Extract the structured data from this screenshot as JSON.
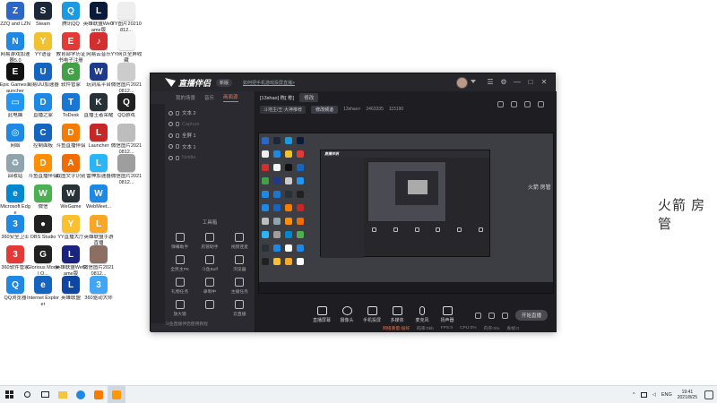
{
  "desktop": {
    "side_text": "火箭 房管",
    "side_small": "火箭 房管",
    "icons": [
      {
        "label": "ZZQ and LZN",
        "color": "#2b66c8",
        "glyph": "Z"
      },
      {
        "label": "Steam",
        "color": "#1b2838",
        "glyph": "S"
      },
      {
        "label": "腾讯QQ",
        "color": "#1a9ae0",
        "glyph": "Q"
      },
      {
        "label": "英雄联盟WeGame版",
        "color": "#0a1a3a",
        "glyph": "L"
      },
      {
        "label": "YY图片20210812...",
        "color": "#eeeeee",
        "glyph": ""
      },
      {
        "label": "网易游戏加速器5.0",
        "color": "#1e88e5",
        "glyph": "N"
      },
      {
        "label": "YY语音",
        "color": "#f2c12e",
        "glyph": "Y"
      },
      {
        "label": "教育部学历证书电子注册",
        "color": "#e53935",
        "glyph": "E"
      },
      {
        "label": "网易云音乐",
        "color": "#d32f2f",
        "glyph": "♪"
      },
      {
        "label": "YY网页全屏收藏",
        "color": "#f5f5f5",
        "glyph": ""
      },
      {
        "label": "Epic Games Launcher",
        "color": "#111111",
        "glyph": "E"
      },
      {
        "label": "网易UU加速器",
        "color": "#1565c0",
        "glyph": "U"
      },
      {
        "label": "软件管家",
        "color": "#43a047",
        "glyph": "G"
      },
      {
        "label": "玩到底平台",
        "color": "#1e3a8a",
        "glyph": "W"
      },
      {
        "label": "微信图片20210812...",
        "color": "#cccccc",
        "glyph": ""
      },
      {
        "label": "此电脑",
        "color": "#2196f3",
        "glyph": "▭"
      },
      {
        "label": "直播之家",
        "color": "#1e88e5",
        "glyph": "D"
      },
      {
        "label": "ToDesk",
        "color": "#1976d2",
        "glyph": "T"
      },
      {
        "label": "直播王者荣耀",
        "color": "#263238",
        "glyph": "K"
      },
      {
        "label": "QQ游戏",
        "color": "#212121",
        "glyph": "Q"
      },
      {
        "label": "网络",
        "color": "#1e88e5",
        "glyph": "◎"
      },
      {
        "label": "控制面板",
        "color": "#1565c0",
        "glyph": "C"
      },
      {
        "label": "斗鱼直播伴侣",
        "color": "#f57c00",
        "glyph": "D"
      },
      {
        "label": "Launcher",
        "color": "#c62828",
        "glyph": "L"
      },
      {
        "label": "微信图片20210812...",
        "color": "#bdbdbd",
        "glyph": ""
      },
      {
        "label": "回收站",
        "color": "#90a4ae",
        "glyph": "♻"
      },
      {
        "label": "斗鱼直播伴侣",
        "color": "#ff8f00",
        "glyph": "D"
      },
      {
        "label": "截图文字识别",
        "color": "#ef6c00",
        "glyph": "A"
      },
      {
        "label": "雷神加速器",
        "color": "#29b6f6",
        "glyph": "L"
      },
      {
        "label": "微信图片20210812...",
        "color": "#9e9e9e",
        "glyph": ""
      },
      {
        "label": "Microsoft Edge",
        "color": "#0288d1",
        "glyph": "e"
      },
      {
        "label": "微信",
        "color": "#4caf50",
        "glyph": "W"
      },
      {
        "label": "WeGame",
        "color": "#263238",
        "glyph": "W"
      },
      {
        "label": "WebMeet...",
        "color": "#1e88e5",
        "glyph": "W"
      },
      {
        "label": "",
        "color": "#ffffff",
        "glyph": ""
      },
      {
        "label": "360安全卫士",
        "color": "#1e88e5",
        "glyph": "3"
      },
      {
        "label": "OBS Studio",
        "color": "#212121",
        "glyph": "●"
      },
      {
        "label": "YY直播大厅",
        "color": "#fbc02d",
        "glyph": "Y"
      },
      {
        "label": "英雄联盟手游直播",
        "color": "#f9a825",
        "glyph": "L"
      },
      {
        "label": "",
        "color": "#ffffff",
        "glyph": ""
      },
      {
        "label": "360软件管家",
        "color": "#e53935",
        "glyph": "3"
      },
      {
        "label": "Glorious Model O...",
        "color": "#212121",
        "glyph": "G"
      },
      {
        "label": "英雄联盟WeGame版",
        "color": "#1a237e",
        "glyph": "L"
      },
      {
        "label": "微信图片20210812...",
        "color": "#8d6e63",
        "glyph": ""
      },
      {
        "label": "",
        "color": "#ffffff",
        "glyph": ""
      },
      {
        "label": "QQ浏览器",
        "color": "#1e88e5",
        "glyph": "Q"
      },
      {
        "label": "Internet Explorer",
        "color": "#1565c0",
        "glyph": "e"
      },
      {
        "label": "英雄联盟",
        "color": "#0d47a1",
        "glyph": "L"
      },
      {
        "label": "360驱动大师",
        "color": "#42a5f5",
        "glyph": "3"
      },
      {
        "label": "",
        "color": "#ffffff",
        "glyph": ""
      }
    ]
  },
  "app": {
    "logo_text": "直播伴侣",
    "version_badge": "新版",
    "notice": "如何把手机游戏投屏直播>",
    "window_controls": [
      "☰",
      "⚙",
      "—",
      "□",
      "✕"
    ],
    "sidebar": {
      "tabs": [
        "我的场景",
        "音乐",
        "画面源"
      ],
      "active_tab": 2,
      "sources": [
        {
          "label": "文本 2",
          "dim": false
        },
        {
          "label": "Capture",
          "dim": true
        },
        {
          "label": "全屏 1",
          "dim": false
        },
        {
          "label": "文本 1",
          "dim": false
        },
        {
          "label": "Nvidia",
          "dim": true
        }
      ],
      "tools_title": "工具箱",
      "tools": [
        {
          "label": "弹幕助手"
        },
        {
          "label": "房管助手"
        },
        {
          "label": "视频连麦"
        },
        {
          "label": "全民主PK"
        },
        {
          "label": "斗鱼Buff"
        },
        {
          "label": "浏览器"
        },
        {
          "label": "礼物任务"
        },
        {
          "label": "录制中"
        },
        {
          "label": "主播任务"
        },
        {
          "label": "放大镜"
        },
        {
          "label": ""
        },
        {
          "label": "云直播"
        }
      ],
      "footer": "斗鱼直播伴侣使用教程"
    },
    "main": {
      "room_name": "[13shao] 栋[ 栋]",
      "edit_label": "修改",
      "category": "斗地主/王·大神推荐",
      "switch_label": "修改频道",
      "user_id": "13shao>",
      "fans": "2463335",
      "online": "115190",
      "preview_logo": "直播伴侣",
      "controls": [
        {
          "label": "直播屏幕"
        },
        {
          "label": "摄像头"
        },
        {
          "label": "手机投屏"
        },
        {
          "label": "多媒体"
        },
        {
          "label": "麦克风"
        },
        {
          "label": "扬声器"
        }
      ],
      "start_live": "开始直播",
      "status": [
        "网络质量:很好",
        "码率:0kb",
        "FPS:0",
        "CPU:0%",
        "内存:0%",
        "丢帧:0"
      ]
    }
  },
  "taskbar": {
    "lang": "ENG",
    "time": "19:41",
    "date": "2021/8/25"
  }
}
